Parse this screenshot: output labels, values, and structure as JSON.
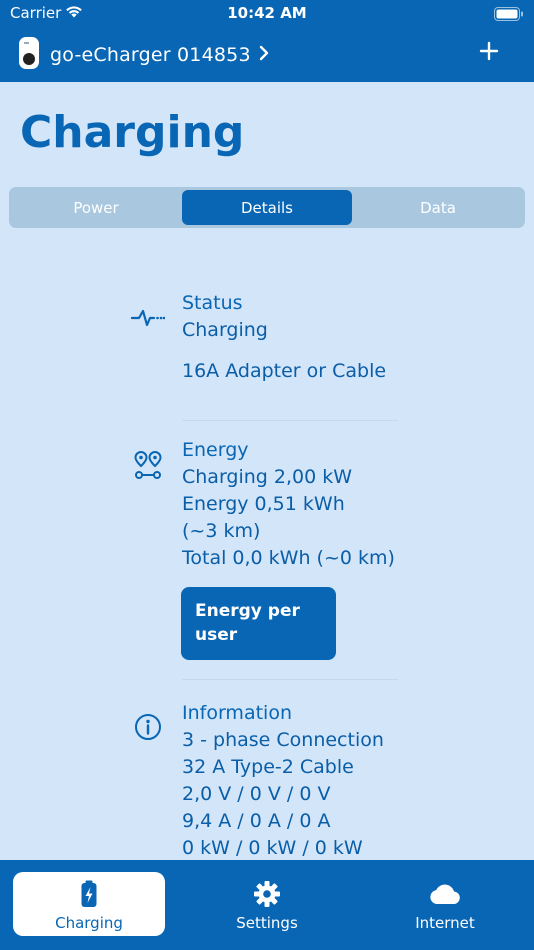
{
  "status_bar": {
    "carrier": "Carrier",
    "time": "10:42 AM"
  },
  "header": {
    "device_name": "go-eCharger 014853",
    "add_label": "+"
  },
  "page": {
    "title": "Charging"
  },
  "segments": [
    {
      "label": "Power",
      "active": false
    },
    {
      "label": "Details",
      "active": true
    },
    {
      "label": "Data",
      "active": false
    }
  ],
  "status_section": {
    "title": "Status",
    "lines": [
      "Charging",
      "16A Adapter or Cable"
    ]
  },
  "energy_section": {
    "title": "Energy",
    "lines": [
      "Charging 2,00 kW",
      "Energy 0,51 kWh",
      "(~3 km)",
      "Total 0,0 kWh (~0 km)"
    ],
    "button_label": "Energy per user"
  },
  "info_section": {
    "title": "Information",
    "lines": [
      "3 - phase Connection",
      "32 A Type-2 Cable",
      "2,0  V / 0 V / 0 V",
      "9,4  A / 0 A / 0 A",
      "0 kW / 0 kW / 0 kW"
    ]
  },
  "tabs": [
    {
      "label": "Charging",
      "icon": "battery-charging-icon",
      "active": true
    },
    {
      "label": "Settings",
      "icon": "gear-icon",
      "active": false
    },
    {
      "label": "Internet",
      "icon": "cloud-icon",
      "active": false
    }
  ],
  "colors": {
    "primary": "#0866b4",
    "background": "#d3e5f8",
    "segment_bg": "#a9c8e0"
  }
}
